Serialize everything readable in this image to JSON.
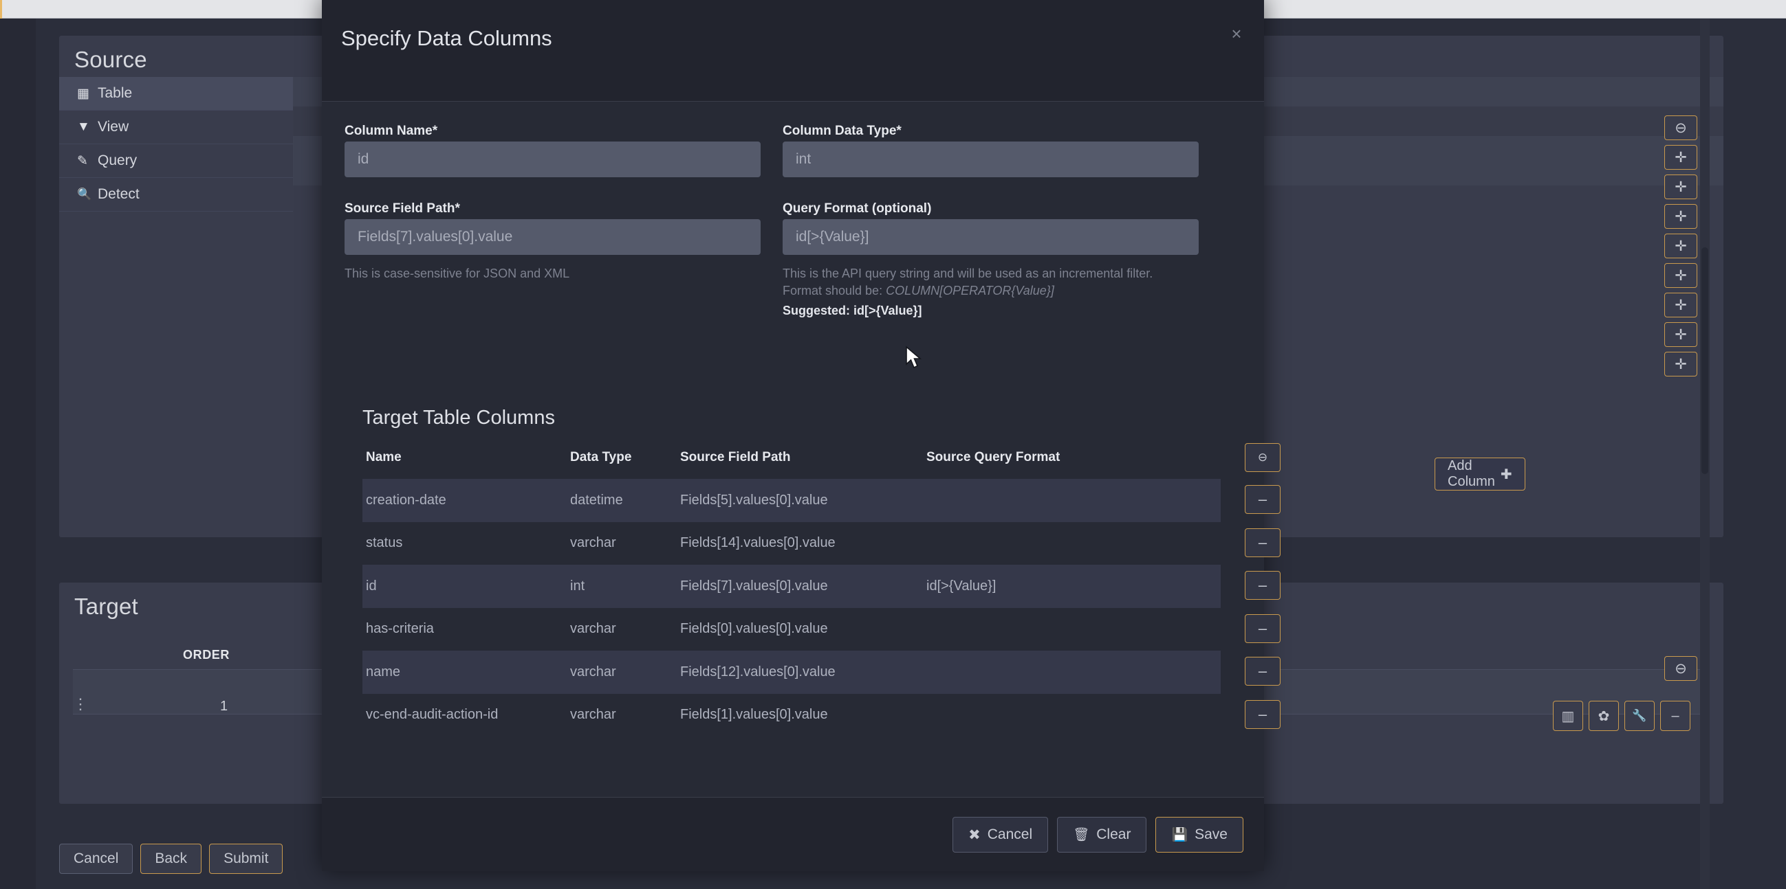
{
  "background": {
    "source": {
      "title": "Source",
      "nav": [
        {
          "label": "Table",
          "icon": "grid-icon",
          "glyph": "▦",
          "active": true
        },
        {
          "label": "View",
          "icon": "filter-icon",
          "glyph": "▼",
          "active": false
        },
        {
          "label": "Query",
          "icon": "edit-icon",
          "glyph": "✎",
          "active": false
        },
        {
          "label": "Detect",
          "icon": "search-icon",
          "glyph": "🔍",
          "active": false
        }
      ],
      "rail_buttons": [
        {
          "icon": "minus-circle-icon",
          "glyph": "⊖"
        },
        {
          "icon": "plus-icon",
          "glyph": "✛"
        },
        {
          "icon": "plus-icon",
          "glyph": "✛"
        },
        {
          "icon": "plus-icon",
          "glyph": "✛"
        },
        {
          "icon": "plus-icon",
          "glyph": "✛"
        },
        {
          "icon": "plus-icon",
          "glyph": "✛"
        },
        {
          "icon": "plus-icon",
          "glyph": "✛"
        },
        {
          "icon": "plus-icon",
          "glyph": "✛"
        },
        {
          "icon": "plus-icon",
          "glyph": "✛"
        }
      ]
    },
    "target": {
      "title": "Target",
      "order_header": "ORDER",
      "order_value": "1",
      "collapse_button": {
        "icon": "minus-circle-icon",
        "glyph": "⊖"
      },
      "icon_buttons": [
        {
          "icon": "columns-icon",
          "glyph": "▥"
        },
        {
          "icon": "gear-icon",
          "glyph": "✿"
        },
        {
          "icon": "wrench-icon",
          "glyph": "🔧"
        },
        {
          "icon": "minus-icon",
          "glyph": "−"
        }
      ]
    },
    "wizard_buttons": [
      {
        "label": "Cancel",
        "accent": false
      },
      {
        "label": "Back",
        "accent": true
      },
      {
        "label": "Submit",
        "accent": true
      }
    ]
  },
  "modal": {
    "title": "Specify Data Columns",
    "close_glyph": "×",
    "fields": {
      "column_name": {
        "label": "Column Name*",
        "value": "",
        "placeholder": "id"
      },
      "column_data_type": {
        "label": "Column Data Type*",
        "value": "",
        "placeholder": "int"
      },
      "source_field_path": {
        "label": "Source Field Path*",
        "value": "",
        "placeholder": "Fields[7].values[0].value",
        "help": "This is case-sensitive for JSON and XML",
        "highlighted": true,
        "highlight_color": "#23a3f0"
      },
      "query_format": {
        "label": "Query Format (optional)",
        "value": "",
        "placeholder": "id[>{Value}]",
        "help_line1": "This is the API query string and will be used as an incremental filter.",
        "help_line2_prefix": "Format should be: ",
        "help_line2_em": "COLUMN[OPERATOR{Value}]",
        "suggested": "Suggested: id[>{Value}]"
      }
    },
    "add_column_button": {
      "label": "Add Column",
      "glyph": "✚"
    },
    "table": {
      "title": "Target Table Columns",
      "headers": [
        "Name",
        "Data Type",
        "Source Field Path",
        "Source Query Format"
      ],
      "header_remove_glyph": "⊖",
      "row_remove_glyph": "–",
      "rows": [
        {
          "name": "creation-date",
          "type": "datetime",
          "path": "Fields[5].values[0].value",
          "query": ""
        },
        {
          "name": "status",
          "type": "varchar",
          "path": "Fields[14].values[0].value",
          "query": ""
        },
        {
          "name": "id",
          "type": "int",
          "path": "Fields[7].values[0].value",
          "query": "id[>{Value}]"
        },
        {
          "name": "has-criteria",
          "type": "varchar",
          "path": "Fields[0].values[0].value",
          "query": ""
        },
        {
          "name": "name",
          "type": "varchar",
          "path": "Fields[12].values[0].value",
          "query": ""
        },
        {
          "name": "vc-end-audit-action-id",
          "type": "varchar",
          "path": "Fields[1].values[0].value",
          "query": ""
        }
      ]
    },
    "footer_buttons": [
      {
        "label": "Cancel",
        "glyph": "✖",
        "accent": false
      },
      {
        "label": "Clear",
        "glyph": "🗑",
        "accent": false
      },
      {
        "label": "Save",
        "glyph": "💾",
        "accent": true
      }
    ]
  }
}
